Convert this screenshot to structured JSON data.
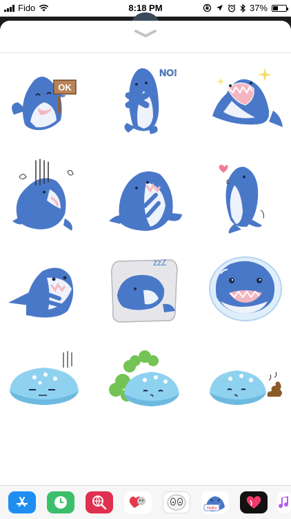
{
  "status_bar": {
    "carrier": "Fido",
    "time": "8:18 PM",
    "battery_percent": "37%",
    "battery_level": 0.37,
    "icons": [
      "signal-bars-icon",
      "wifi-icon",
      "orientation-lock-icon",
      "location-arrow-icon",
      "alarm-clock-icon",
      "bluetooth-icon",
      "battery-icon"
    ]
  },
  "sticker_drawer": {
    "handle_icon": "chevron-down-icon",
    "stickers": [
      {
        "id": "shark-ok-sign",
        "text": "OK"
      },
      {
        "id": "shark-no",
        "text": "NO!"
      },
      {
        "id": "shark-sparkle-lying",
        "text": ""
      },
      {
        "id": "shark-gloom",
        "text": ""
      },
      {
        "id": "shark-shy",
        "text": ""
      },
      {
        "id": "shark-love-side",
        "text": ""
      },
      {
        "id": "shark-peek",
        "text": ""
      },
      {
        "id": "shark-sleep-pillow",
        "text": "zzZ"
      },
      {
        "id": "shark-bubble",
        "text": ""
      },
      {
        "id": "whale-annoyed",
        "text": ""
      },
      {
        "id": "whale-fart",
        "text": ""
      },
      {
        "id": "whale-poop",
        "text": ""
      }
    ]
  },
  "app_tray": {
    "apps": [
      "app-store-icon",
      "activity-clock-icon",
      "web-search-icon",
      "heart-sticker-app-icon",
      "face-sticker-app-icon",
      "shark-sticker-app-icon",
      "heart-app-icon",
      "music-icon"
    ],
    "shark_app_label": "Hello"
  },
  "colors": {
    "shark_blue": "#4a78c8",
    "whale_blue": "#8fd2f0",
    "sheet_background": "#ffffff"
  }
}
